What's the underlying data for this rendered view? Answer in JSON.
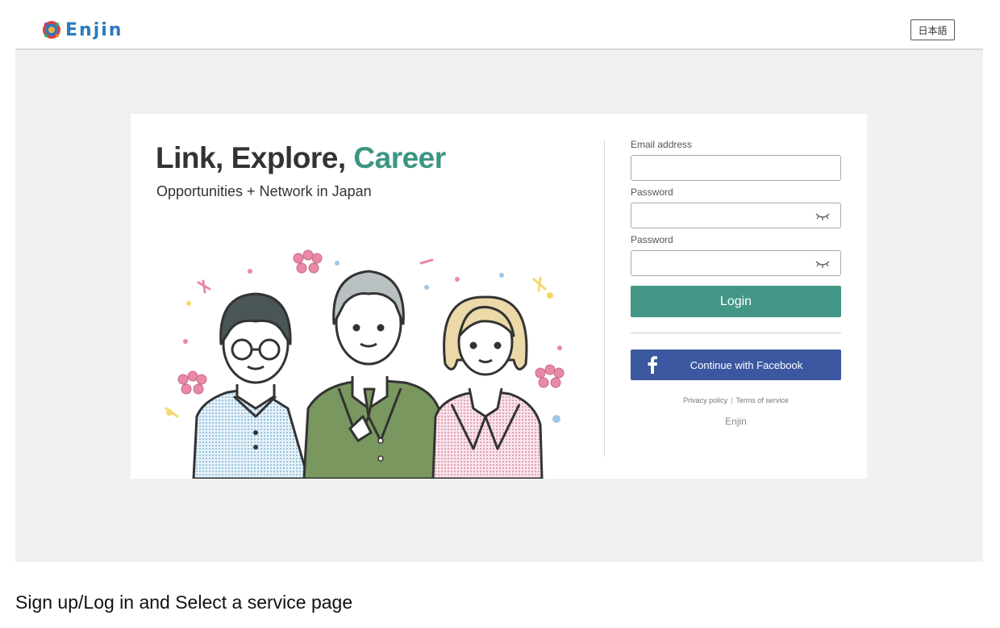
{
  "header": {
    "logo_text": "Enjin",
    "language_button": "日本語"
  },
  "hero": {
    "title_part1": "Link, Explore, ",
    "title_accent": "Career",
    "subtitle": "Opportunities + Network in Japan"
  },
  "login_form": {
    "email_label": "Email address",
    "email_value": "",
    "password_label": "Password",
    "password_value": "",
    "password_confirm_label": "Password",
    "password_confirm_value": "",
    "login_button": "Login",
    "facebook_button": "Continue with Facebook",
    "privacy_link": "Privacy policy",
    "separator": "|",
    "terms_link": "Terms of service",
    "brand": "Enjin"
  },
  "caption": "Sign up/Log in and Select a service page",
  "colors": {
    "accent": "#3c9583",
    "login_button": "#429685",
    "facebook": "#3b57a0",
    "stage_background": "#f1f1f1"
  },
  "icons": [
    "enjin-logo-icon",
    "eye-closed-icon",
    "facebook-icon"
  ]
}
